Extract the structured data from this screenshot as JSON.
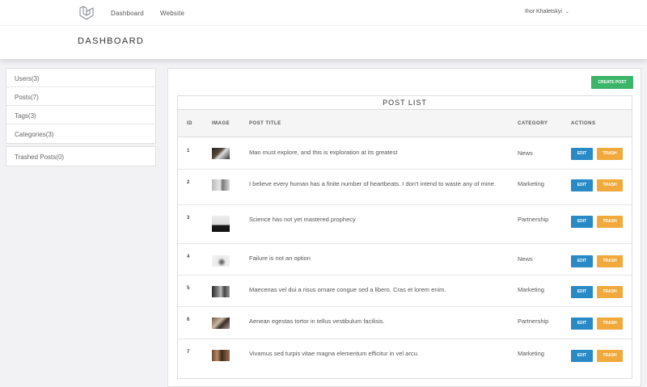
{
  "header": {
    "logo_icon": "laravel-logo-icon",
    "nav": [
      "Dashboard",
      "Website"
    ],
    "user_name": "Ihor Khaletskyi"
  },
  "page": {
    "title": "DASHBOARD"
  },
  "sidebar": {
    "items": [
      "Users(3)",
      "Posts(7)",
      "Tags(3)",
      "Categories(3)"
    ],
    "trashed": "Trashed Posts(0)"
  },
  "posts": {
    "create_label": "CREATE POST",
    "list_title": "POST LIST",
    "columns": [
      "ID",
      "IMAGE",
      "POST TITLE",
      "CATEGORY",
      "ACTIONS"
    ],
    "edit_label": "EDIT",
    "trash_label": "TRASH",
    "rows": [
      {
        "id": "1",
        "title": "Man must explore, and this is exploration at its greatest",
        "category": "News"
      },
      {
        "id": "2",
        "title": "I believe every human has a finite number of heartbeats. I don't intend to waste any of mine.",
        "category": "Marketing"
      },
      {
        "id": "3",
        "title": "Science has not yet mastered prophecy",
        "category": "Partnership"
      },
      {
        "id": "4",
        "title": "Failure is not an option",
        "category": "News"
      },
      {
        "id": "5",
        "title": "Maecenas vel dui a risus ornare congue sed a libero. Cras et lorem enim.",
        "category": "Marketing"
      },
      {
        "id": "6",
        "title": "Aenean egestas tortor in tellus vestibulum facilisis.",
        "category": "Partnership"
      },
      {
        "id": "7",
        "title": "Vivamus sed turpis vitae magna elementum efficitur in vel arcu.",
        "category": "Marketing"
      }
    ]
  },
  "colors": {
    "create_button": "#3cb469",
    "edit_button": "#2a8ac6",
    "trash_button": "#f0a93a"
  }
}
